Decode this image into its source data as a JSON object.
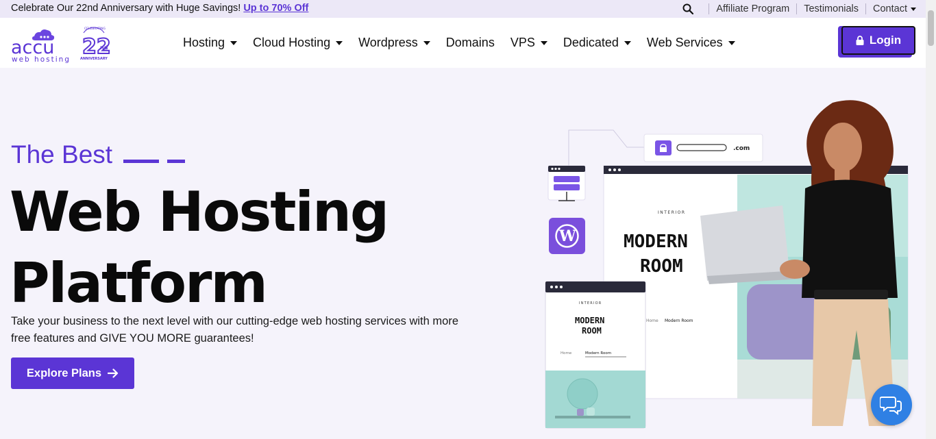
{
  "topbar": {
    "promo_text": "Celebrate Our 22nd Anniversary with Huge Savings!",
    "promo_link": "Up to 70% Off",
    "links": [
      "Affiliate Program",
      "Testimonials",
      "Contact"
    ]
  },
  "header": {
    "logo_text": "accu",
    "logo_subtext": "web hosting",
    "badge_number": "22",
    "badge_suffix": "nd",
    "badge_top": "CELEBRATING",
    "badge_bottom": "ANNIVERSARY",
    "nav": [
      "Hosting",
      "Cloud Hosting",
      "Wordpress",
      "Domains",
      "VPS",
      "Dedicated",
      "Web Services"
    ],
    "login_label": "Login"
  },
  "hero": {
    "subtitle": "The Best",
    "title_line1": "Web Hosting",
    "title_line2": "Platform",
    "description": "Take your business to the next level with our cutting-edge web hosting services with more free features and GIVE YOU MORE guarantees!",
    "cta_label": "Explore Plans"
  },
  "illustration": {
    "domain_suffix": ".com",
    "interior_label": "INTERIOR",
    "room_title_1": "MODERN",
    "room_title_2": "ROOM",
    "breadcrumb_home": "Home",
    "breadcrumb_page": "Modern Room"
  },
  "colors": {
    "brand": "#5b35d5",
    "topbar_bg": "#ece8f7",
    "page_bg": "#f5f3fb",
    "chat": "#2f80e4"
  }
}
